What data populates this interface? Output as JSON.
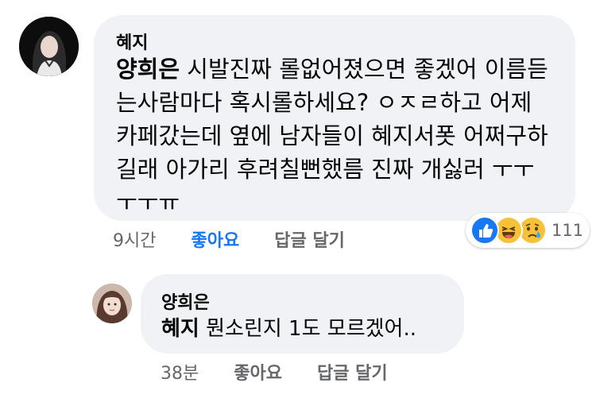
{
  "comment": {
    "author": "혜지",
    "mention": "양희은",
    "line1_rest": " 시발진짜 롤없어졌으면 좋겠어 이름듣",
    "line2": "는사람마다  혹시롤하세요? ㅇㅈㄹ하고 어제",
    "line3": "카페갔는데 옆에 남자들이 혜지서폿 어쩌구하",
    "line4": "길래 아가리 후려칠뻔했름 진짜 개싫러 ㅜㅜ",
    "line5": "ㅜㅜㅠ",
    "time": "9시간",
    "like_label": "좋아요",
    "reply_label": "답글 달기",
    "reaction_count": "111",
    "reaction_icons": [
      "like-icon",
      "laughing-icon",
      "sad-icon"
    ]
  },
  "reply": {
    "author": "양희은",
    "mention": "혜지",
    "text_rest": " 뭔소린지 1도 모르겠어..",
    "time": "38분",
    "like_label": "좋아요",
    "reply_label": "답글 달기"
  },
  "colors": {
    "bubble": "#f0f2f5",
    "like_active": "#1877f2",
    "meta_text": "#65676b"
  }
}
